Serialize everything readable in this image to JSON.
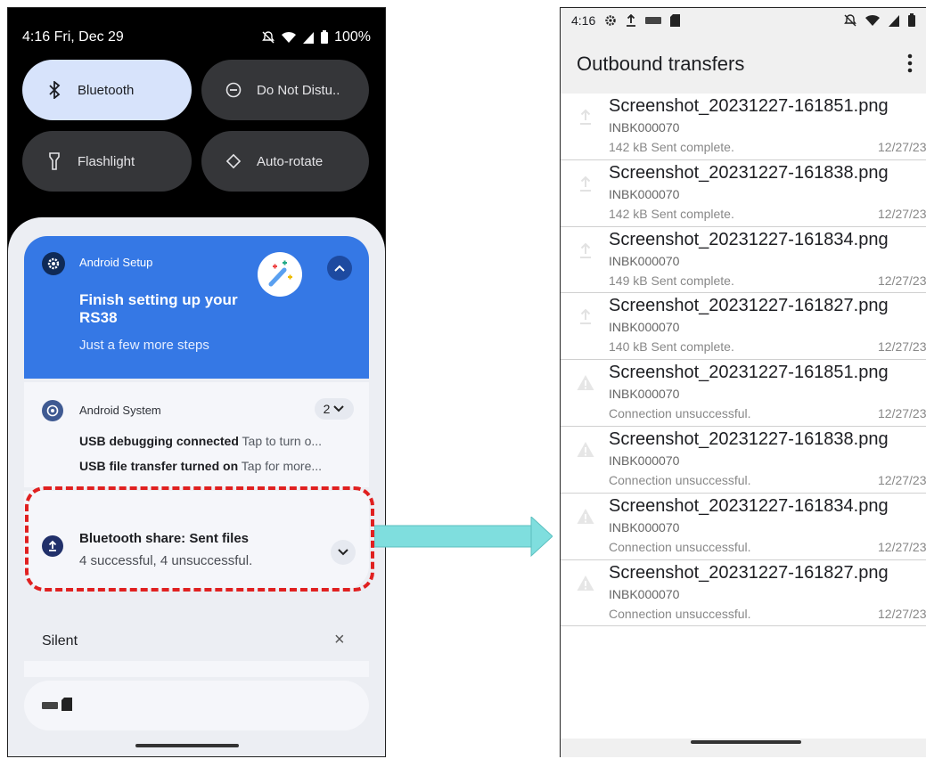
{
  "left_status": {
    "time_date": "4:16  Fri, Dec 29",
    "battery": "100%"
  },
  "tiles": [
    {
      "label": "Bluetooth"
    },
    {
      "label": "Do Not Distu.."
    },
    {
      "label": "Flashlight"
    },
    {
      "label": "Auto-rotate"
    }
  ],
  "setup_notif": {
    "app": "Android Setup",
    "title": "Finish setting up your RS38",
    "subtitle": "Just a few more steps"
  },
  "system_notif": {
    "app": "Android System",
    "count": "2",
    "lines": [
      {
        "bold": "USB debugging connected",
        "rest": " Tap to turn o..."
      },
      {
        "bold": "USB file transfer turned on",
        "rest": " Tap for more..."
      }
    ]
  },
  "bt_notif": {
    "title": "Bluetooth share: Sent files",
    "subtitle": "4 successful, 4 unsuccessful."
  },
  "silent": {
    "label": "Silent",
    "close": "×"
  },
  "right_status": {
    "time": "4:16"
  },
  "transfers": {
    "title": "Outbound transfers",
    "items": [
      {
        "file": "Screenshot_20231227-161851.png",
        "device": "INBK000070",
        "status": "142 kB Sent complete.",
        "date": "12/27/23",
        "kind": "upload"
      },
      {
        "file": "Screenshot_20231227-161838.png",
        "device": "INBK000070",
        "status": "142 kB Sent complete.",
        "date": "12/27/23",
        "kind": "upload"
      },
      {
        "file": "Screenshot_20231227-161834.png",
        "device": "INBK000070",
        "status": "149 kB Sent complete.",
        "date": "12/27/23",
        "kind": "upload"
      },
      {
        "file": "Screenshot_20231227-161827.png",
        "device": "INBK000070",
        "status": "140 kB Sent complete.",
        "date": "12/27/23",
        "kind": "upload"
      },
      {
        "file": "Screenshot_20231227-161851.png",
        "device": "INBK000070",
        "status": "Connection unsuccessful.",
        "date": "12/27/23",
        "kind": "warning"
      },
      {
        "file": "Screenshot_20231227-161838.png",
        "device": "INBK000070",
        "status": "Connection unsuccessful.",
        "date": "12/27/23",
        "kind": "warning"
      },
      {
        "file": "Screenshot_20231227-161834.png",
        "device": "INBK000070",
        "status": "Connection unsuccessful.",
        "date": "12/27/23",
        "kind": "warning"
      },
      {
        "file": "Screenshot_20231227-161827.png",
        "device": "INBK000070",
        "status": "Connection unsuccessful.",
        "date": "12/27/23",
        "kind": "warning"
      }
    ]
  },
  "colors": {
    "accent": "#3578e5",
    "highlight": "#e02020",
    "arrow": "#7fdede"
  }
}
